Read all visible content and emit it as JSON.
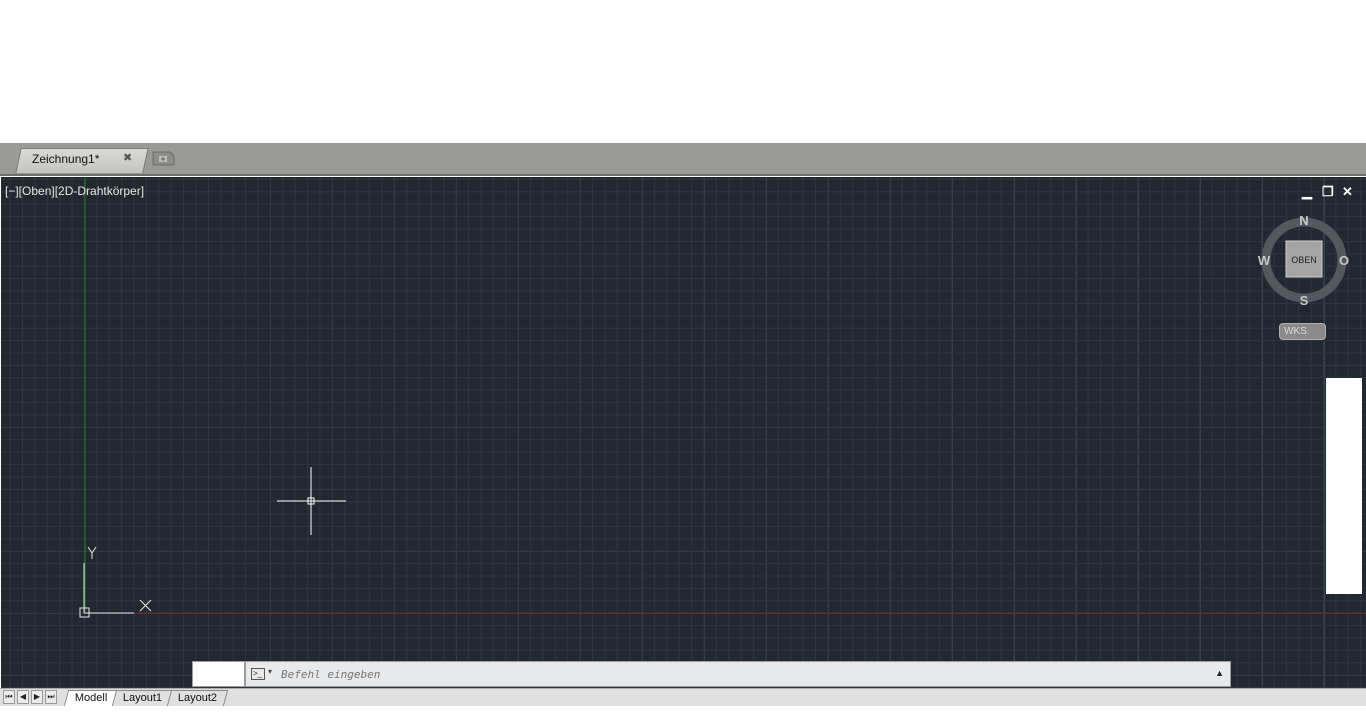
{
  "document_tabs": [
    {
      "label": "Zeichnung1*",
      "close_glyph": "✖"
    }
  ],
  "viewport": {
    "label": "[−][Oben][2D-Drahtkörper]",
    "controls": {
      "minimize": "▁",
      "restore": "❐",
      "close": "✕"
    }
  },
  "viewcube": {
    "north": "N",
    "south": "S",
    "west": "W",
    "east": "O",
    "face": "OBEN",
    "ucs": "WKS"
  },
  "ucs_icon": {
    "x_label": "X",
    "y_label": "Y"
  },
  "command_line": {
    "placeholder": "Befehl eingeben",
    "value": ""
  },
  "layout_tabs": [
    "Modell",
    "Layout1",
    "Layout2"
  ],
  "layout_nav": [
    "⏮",
    "◀",
    "▶",
    "⏭"
  ],
  "colors": {
    "canvas": "#212830",
    "x_axis": "#7a2a2a",
    "y_axis": "#2f7a2f"
  }
}
